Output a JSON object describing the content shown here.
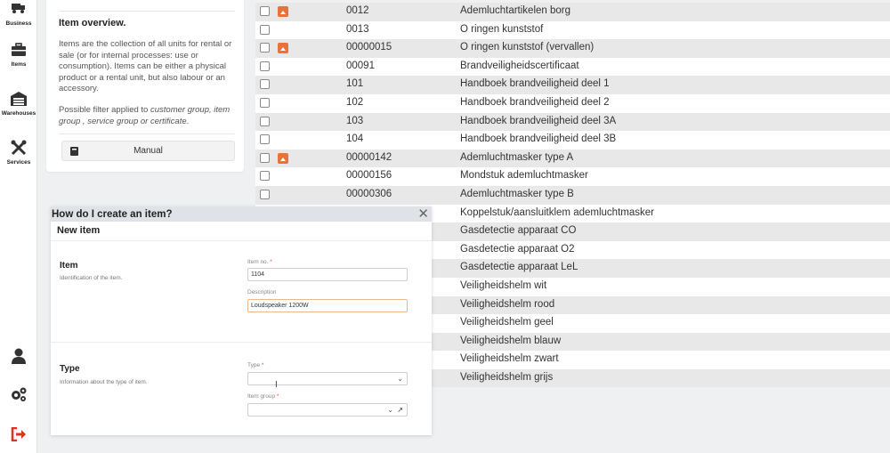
{
  "sidebar": {
    "items": [
      {
        "label": "Business",
        "icon": "truck-icon"
      },
      {
        "label": "Items",
        "icon": "toolbox-icon"
      },
      {
        "label": "Warehouses",
        "icon": "warehouse-icon"
      },
      {
        "label": "Services",
        "icon": "tools-icon"
      }
    ],
    "bottom": [
      {
        "icon": "user-icon"
      },
      {
        "icon": "settings-cogs-icon"
      },
      {
        "icon": "logout-icon",
        "color": "#d9341f"
      }
    ]
  },
  "info": {
    "title": "Item overview.",
    "body": "Items are the collection of all units for rental or sale (or for internal processes: use or consumption). Items can be either a physical product or a rental unit, but also labour or an accessory.",
    "filter_prefix": "Possible filter applied to ",
    "filter_em": "customer group, item group , service group or certificate",
    "filter_suffix": ".",
    "manual_label": "Manual"
  },
  "table": {
    "rows": [
      {
        "num": "0012",
        "desc": "Ademluchtartikelen borg",
        "checkbox": true,
        "image": true
      },
      {
        "num": "0013",
        "desc": "O ringen kunststof",
        "checkbox": true,
        "image": false
      },
      {
        "num": "00000015",
        "desc": "O ringen kunststof (vervallen)",
        "checkbox": true,
        "image": true
      },
      {
        "num": "00091",
        "desc": "Brandveiligheidscertificaat",
        "checkbox": true,
        "image": false
      },
      {
        "num": "101",
        "desc": "Handboek brandveiligheid deel 1",
        "checkbox": true,
        "image": false
      },
      {
        "num": "102",
        "desc": "Handboek brandveiligheid deel 2",
        "checkbox": true,
        "image": false
      },
      {
        "num": "103",
        "desc": "Handboek brandveiligheid deel 3A",
        "checkbox": true,
        "image": false
      },
      {
        "num": "104",
        "desc": "Handboek brandveiligheid deel 3B",
        "checkbox": true,
        "image": false
      },
      {
        "num": "00000142",
        "desc": "Ademluchtmasker type A",
        "checkbox": true,
        "image": true
      },
      {
        "num": "00000156",
        "desc": "Mondstuk ademluchtmasker",
        "checkbox": true,
        "image": false
      },
      {
        "num": "00000306",
        "desc": "Ademluchtmasker type B",
        "checkbox": true,
        "image": false
      },
      {
        "num": "",
        "desc": "Koppelstuk/aansluitklem ademluchtmasker",
        "checkbox": false,
        "image": false
      },
      {
        "num": "",
        "desc": "Gasdetectie apparaat CO",
        "checkbox": false,
        "image": false
      },
      {
        "num": "",
        "desc": "Gasdetectie apparaat O2",
        "checkbox": false,
        "image": false
      },
      {
        "num": "",
        "desc": "Gasdetectie apparaat LeL",
        "checkbox": false,
        "image": false
      },
      {
        "num": "",
        "desc": "Veiligheidshelm wit",
        "checkbox": false,
        "image": false
      },
      {
        "num": "",
        "desc": "Veiligheidshelm rood",
        "checkbox": false,
        "image": false
      },
      {
        "num": "",
        "desc": "Veiligheidshelm geel",
        "checkbox": false,
        "image": false
      },
      {
        "num": "",
        "desc": "Veiligheidshelm blauw",
        "checkbox": false,
        "image": false
      },
      {
        "num": "",
        "desc": "Veiligheidshelm zwart",
        "checkbox": false,
        "image": false
      },
      {
        "num": "",
        "desc": "Veiligheidshelm grijs",
        "checkbox": false,
        "image": false
      }
    ]
  },
  "dialog": {
    "title": "How do I create an item?",
    "subtitle": "New item",
    "item_section": {
      "title": "Item",
      "desc": "Identification of the item.",
      "item_no_label": "Item no.",
      "item_no_value": "1104",
      "description_label": "Description",
      "description_value": "Loudspeaker 1200W"
    },
    "type_section": {
      "title": "Type",
      "desc": "Information about the type of item.",
      "type_label": "Type",
      "type_value": "",
      "item_group_label": "Item group",
      "item_group_value": ""
    },
    "required_mark": "*",
    "accent_color": "#e05a2a"
  }
}
